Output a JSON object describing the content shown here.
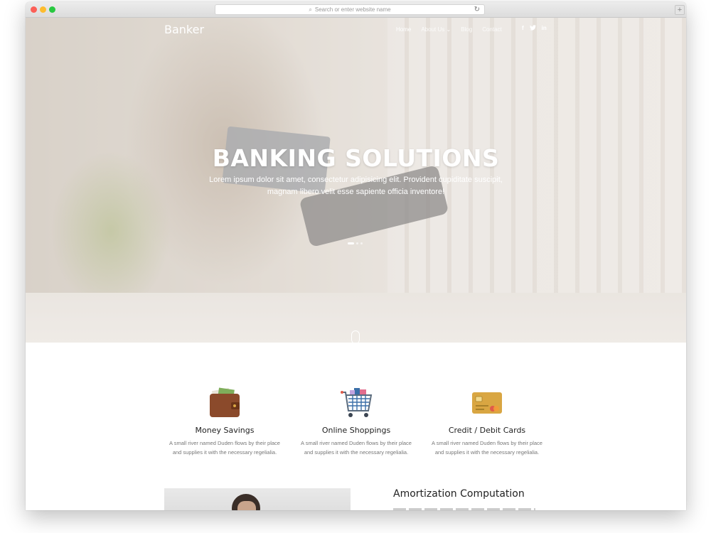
{
  "browser": {
    "url_placeholder": "Search or enter website name",
    "newtab_label": "+"
  },
  "nav": {
    "brand": "Banker",
    "items": [
      {
        "label": "Home",
        "active": true
      },
      {
        "label": "About Us ⌄",
        "active": false
      },
      {
        "label": "Blog",
        "active": false
      },
      {
        "label": "Contact",
        "active": false
      }
    ],
    "social": [
      "f",
      "t",
      "in"
    ]
  },
  "hero": {
    "title": "BANKING SOLUTIONS",
    "subtitle_line1": "Lorem ipsum dolor sit amet, consectetur adipisicing elit. Provident cupiditate suscipit,",
    "subtitle_line2": "magnam libero velit esse sapiente officia inventore!",
    "slide_count": 3,
    "active_slide": 1
  },
  "services": [
    {
      "icon": "wallet-icon",
      "title": "Money Savings",
      "text": "A small river named Duden flows by their place and supplies it with the necessary regelialia."
    },
    {
      "icon": "shopping-cart-icon",
      "title": "Online Shoppings",
      "text": "A small river named Duden flows by their place and supplies it with the necessary regelialia."
    },
    {
      "icon": "credit-card-icon",
      "title": "Credit / Debit Cards",
      "text": "A small river named Duden flows by their place and supplies it with the necessary regelialia."
    }
  ],
  "section": {
    "heading": "Amortization Computation"
  },
  "colors": {
    "hero_text": "#ffffff",
    "wallet": "#8b4a2b",
    "cart": "#3b6fa8",
    "card": "#d9a642"
  }
}
